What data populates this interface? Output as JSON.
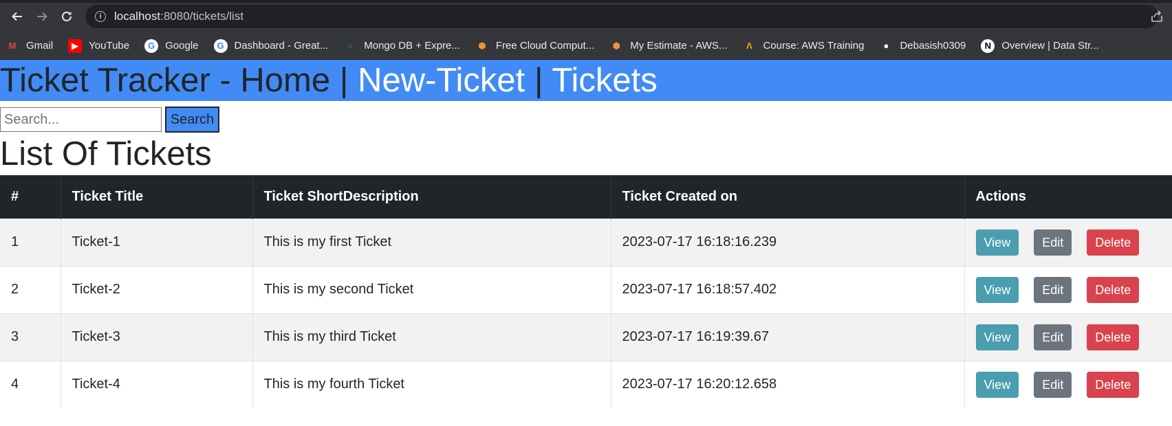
{
  "browser": {
    "url_host": "localhost",
    "url_path": ":8080/tickets/list",
    "bookmarks": [
      {
        "label": "Gmail",
        "icon": "gmail-icon"
      },
      {
        "label": "YouTube",
        "icon": "youtube-icon"
      },
      {
        "label": "Google",
        "icon": "google-icon"
      },
      {
        "label": "Dashboard - Great...",
        "icon": "google-icon"
      },
      {
        "label": "Mongo DB + Expre...",
        "icon": "mongo-icon"
      },
      {
        "label": "Free Cloud Comput...",
        "icon": "aws-box-icon"
      },
      {
        "label": "My Estimate - AWS...",
        "icon": "aws-box-icon"
      },
      {
        "label": "Course: AWS Training",
        "icon": "course-icon"
      },
      {
        "label": "Debasish0309",
        "icon": "github-icon"
      },
      {
        "label": "Overview | Data Str...",
        "icon": "notion-icon"
      }
    ]
  },
  "header": {
    "brand": "Ticket Tracker - Home",
    "sep1": " | ",
    "new_ticket": "New-Ticket",
    "sep2": " | ",
    "tickets": "Tickets"
  },
  "search": {
    "placeholder": "Search...",
    "button_label": "Search"
  },
  "page_title": "List Of Tickets",
  "table": {
    "columns": [
      "#",
      "Ticket Title",
      "Ticket ShortDescription",
      "Ticket Created on",
      "Actions"
    ],
    "rows": [
      {
        "id": "1",
        "title": "Ticket-1",
        "desc": "This is my first Ticket",
        "created": "2023-07-17 16:18:16.239"
      },
      {
        "id": "2",
        "title": "Ticket-2",
        "desc": "This is my second Ticket",
        "created": "2023-07-17 16:18:57.402"
      },
      {
        "id": "3",
        "title": "Ticket-3",
        "desc": "This is my third Ticket",
        "created": "2023-07-17 16:19:39.67"
      },
      {
        "id": "4",
        "title": "Ticket-4",
        "desc": "This is my fourth Ticket",
        "created": "2023-07-17 16:20:12.658"
      }
    ],
    "actions": {
      "view": "View",
      "edit": "Edit",
      "delete": "Delete"
    }
  },
  "colors": {
    "banner": "#428bf5",
    "table_header": "#212529",
    "view_button": "#4a9eaf",
    "edit_button": "#6c757d",
    "delete_button": "#d9434d"
  }
}
